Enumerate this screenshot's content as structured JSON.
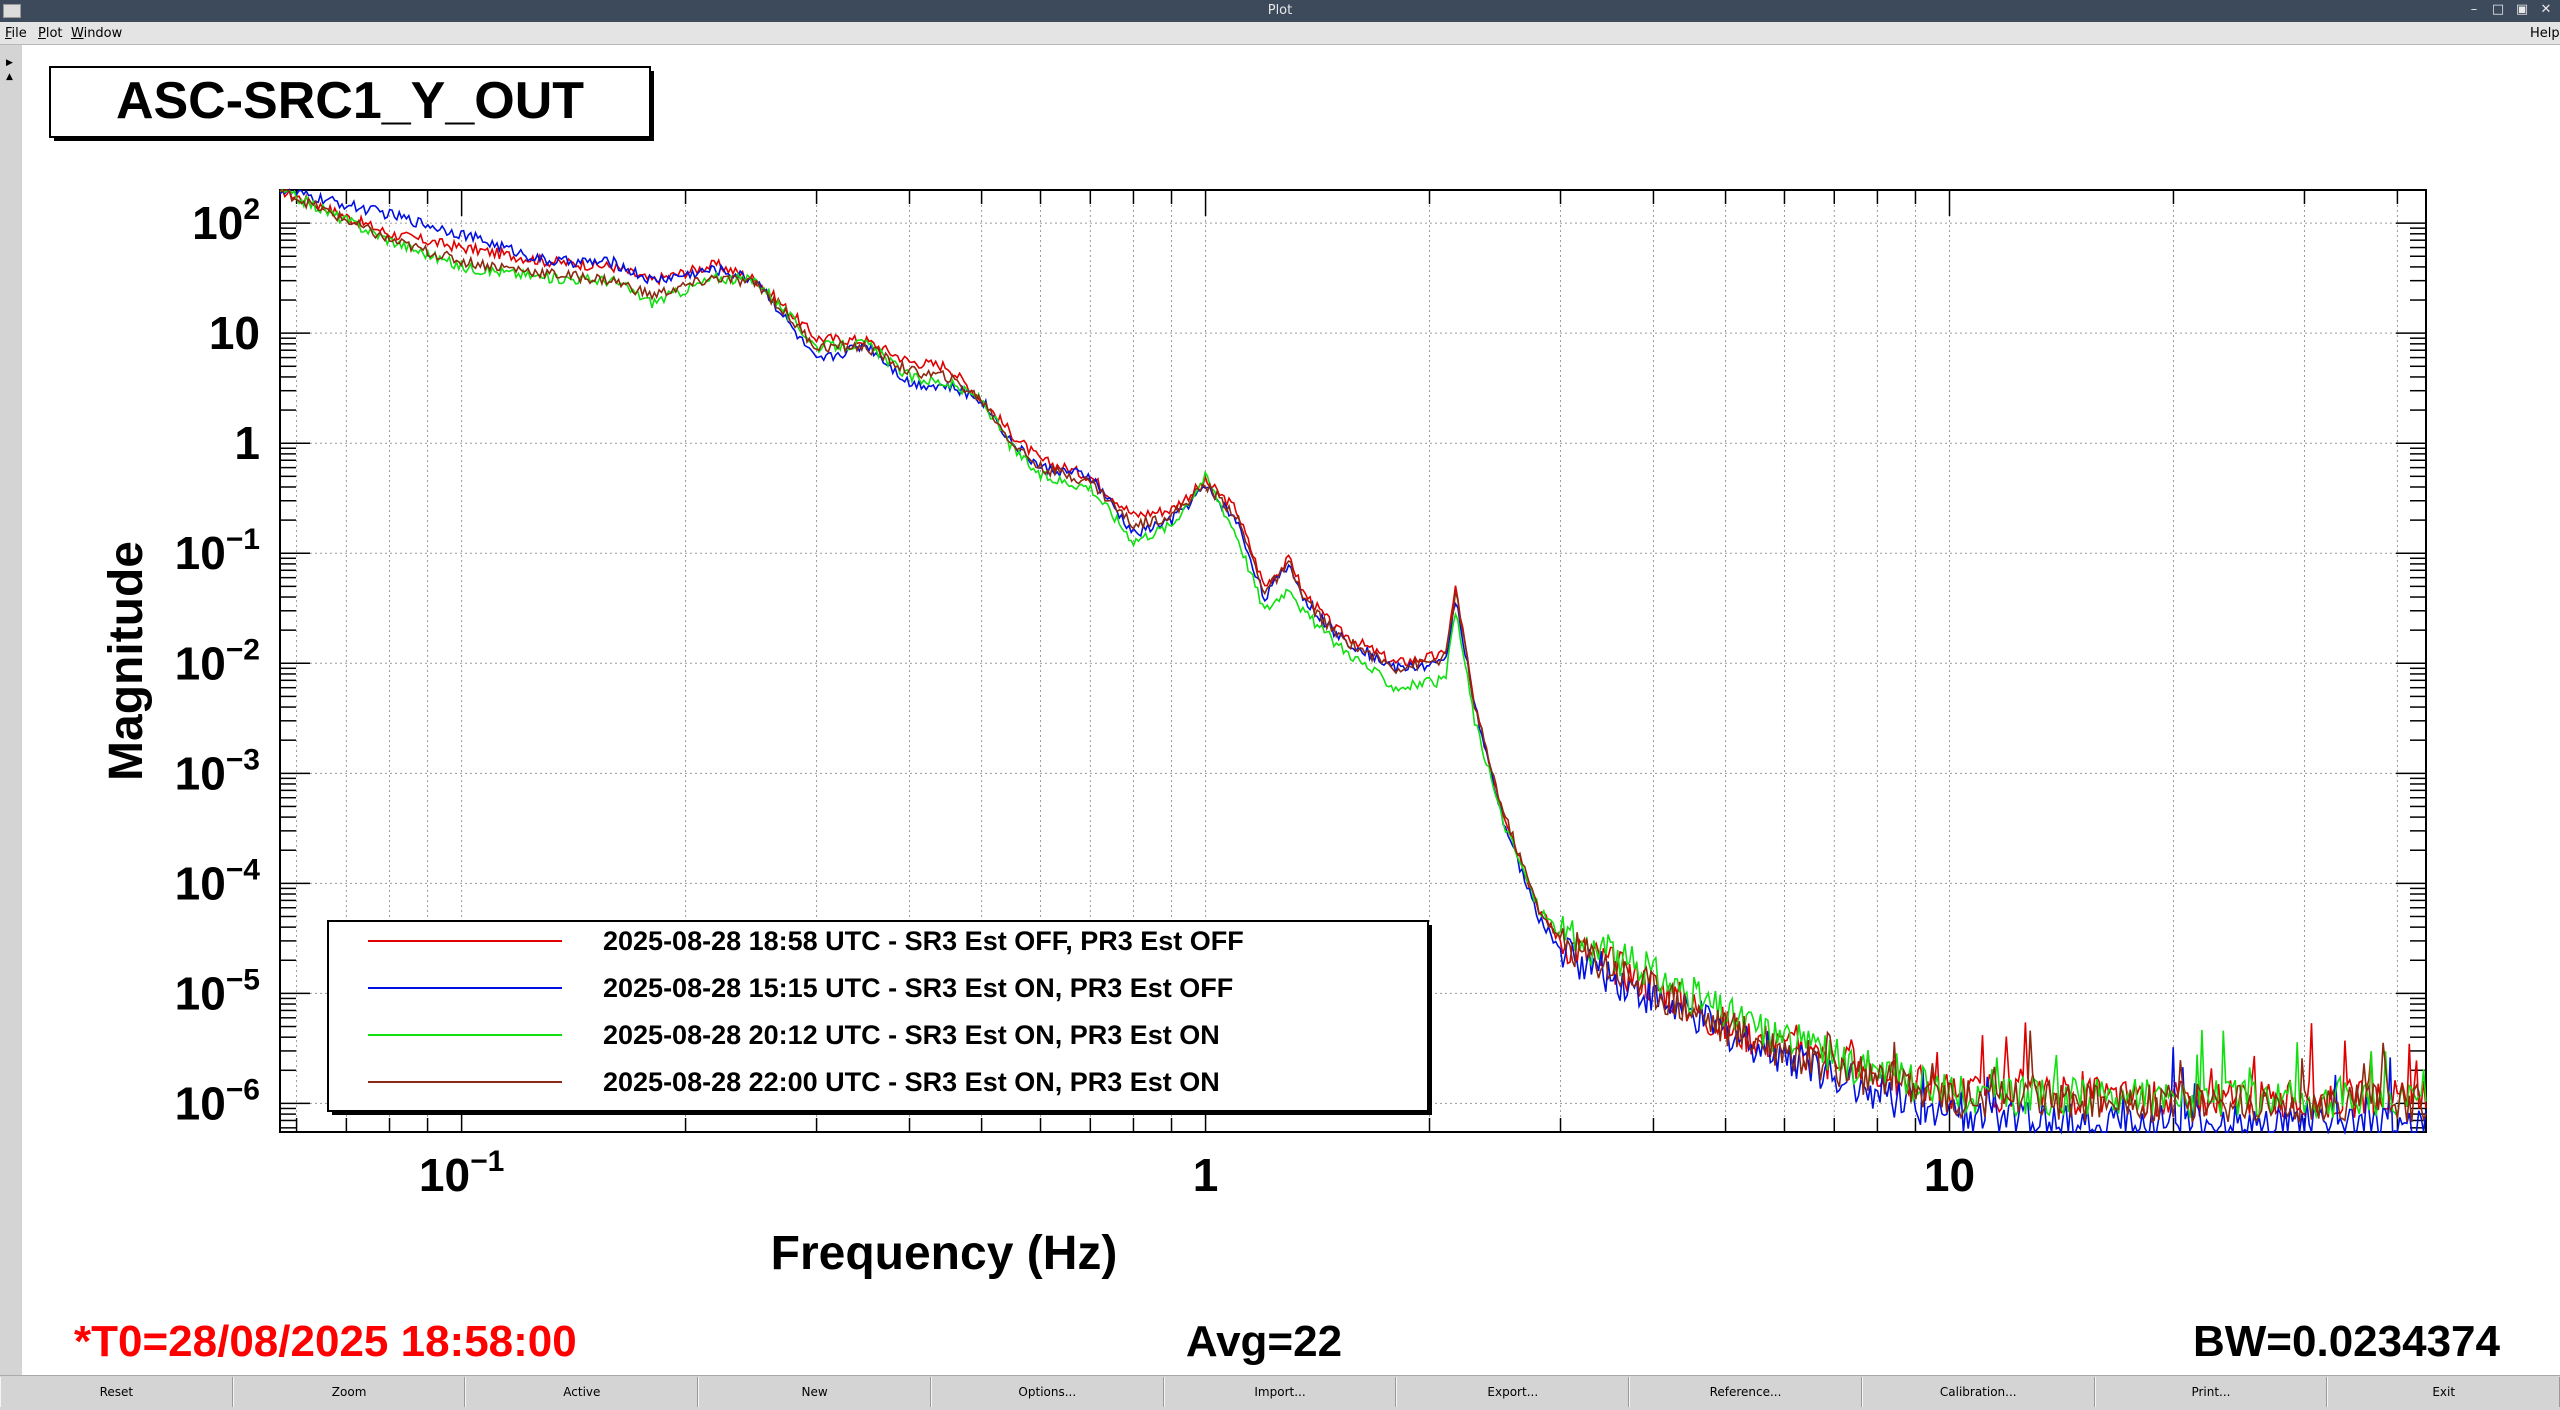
{
  "window": {
    "title": "Plot"
  },
  "menu": [
    {
      "label": "File",
      "key": "F"
    },
    {
      "label": "Plot",
      "key": "P"
    },
    {
      "label": "Window",
      "key": "W"
    }
  ],
  "menu_help": "Help",
  "plot": {
    "title_box": "ASC-SRC1_Y_OUT",
    "footer": {
      "t0": "*T0=28/08/2025 18:58:00",
      "avg": "Avg=22",
      "bw": "BW=0.0234374"
    },
    "legend_colors": [
      "#e00000",
      "#0010e0",
      "#10e010",
      "#8b2a10"
    ]
  },
  "chart_data": {
    "type": "line",
    "title": "",
    "xlabel": "Frequency (Hz)",
    "ylabel": "Magnitude",
    "xscale": "log",
    "yscale": "log",
    "xlim": [
      0.057,
      43.7
    ],
    "ylim": [
      5.5e-07,
      200
    ],
    "grid": true,
    "legend_position": "bottom-left",
    "x_ticks": [
      {
        "value": 0.1,
        "base": "10",
        "exp": "−1"
      },
      {
        "value": 1,
        "base": "1",
        "exp": ""
      },
      {
        "value": 10,
        "base": "10",
        "exp": ""
      }
    ],
    "y_ticks": [
      {
        "value": 100,
        "base": "10",
        "exp": "2"
      },
      {
        "value": 10,
        "base": "10",
        "exp": ""
      },
      {
        "value": 1,
        "base": "1",
        "exp": ""
      },
      {
        "value": 0.1,
        "base": "10",
        "exp": "−1"
      },
      {
        "value": 0.01,
        "base": "10",
        "exp": "−2"
      },
      {
        "value": 0.001,
        "base": "10",
        "exp": "−3"
      },
      {
        "value": 0.0001,
        "base": "10",
        "exp": "−4"
      },
      {
        "value": 1e-05,
        "base": "10",
        "exp": "−5"
      },
      {
        "value": 1e-06,
        "base": "10",
        "exp": "−6"
      }
    ],
    "series": [
      {
        "name": "2025-08-28 18:58 UTC - SR3 Est OFF, PR3 Est OFF",
        "color": "#e00000",
        "points": [
          [
            0.057,
            200
          ],
          [
            0.08,
            80
          ],
          [
            0.1,
            60
          ],
          [
            0.13,
            45
          ],
          [
            0.16,
            40
          ],
          [
            0.18,
            30
          ],
          [
            0.22,
            42
          ],
          [
            0.25,
            30
          ],
          [
            0.3,
            9
          ],
          [
            0.35,
            8.5
          ],
          [
            0.4,
            5.5
          ],
          [
            0.45,
            5
          ],
          [
            0.5,
            2.5
          ],
          [
            0.55,
            1.2
          ],
          [
            0.6,
            0.7
          ],
          [
            0.7,
            0.5
          ],
          [
            0.8,
            0.22
          ],
          [
            0.9,
            0.25
          ],
          [
            1.0,
            0.45
          ],
          [
            1.1,
            0.25
          ],
          [
            1.2,
            0.05
          ],
          [
            1.3,
            0.09
          ],
          [
            1.35,
            0.045
          ],
          [
            1.5,
            0.02
          ],
          [
            1.8,
            0.01
          ],
          [
            2.1,
            0.012
          ],
          [
            2.17,
            0.05
          ],
          [
            2.3,
            0.004
          ],
          [
            2.5,
            0.0005
          ],
          [
            2.8,
            6e-05
          ],
          [
            3.0,
            3e-05
          ],
          [
            4,
            1.2e-05
          ],
          [
            5,
            5e-06
          ],
          [
            7,
            2.3e-06
          ],
          [
            10,
            1.3e-06
          ],
          [
            20,
            1.1e-06
          ],
          [
            40,
            1.1e-06
          ]
        ]
      },
      {
        "name": "2025-08-28 15:15 UTC - SR3 Est ON, PR3 Est OFF",
        "color": "#0010e0",
        "points": [
          [
            0.057,
            200
          ],
          [
            0.08,
            120
          ],
          [
            0.1,
            80
          ],
          [
            0.13,
            45
          ],
          [
            0.16,
            44
          ],
          [
            0.18,
            30
          ],
          [
            0.22,
            38
          ],
          [
            0.25,
            30
          ],
          [
            0.3,
            5.5
          ],
          [
            0.35,
            8
          ],
          [
            0.4,
            3.5
          ],
          [
            0.45,
            3.3
          ],
          [
            0.5,
            2.5
          ],
          [
            0.55,
            1
          ],
          [
            0.6,
            0.6
          ],
          [
            0.7,
            0.5
          ],
          [
            0.8,
            0.15
          ],
          [
            0.9,
            0.2
          ],
          [
            1.0,
            0.4
          ],
          [
            1.1,
            0.2
          ],
          [
            1.2,
            0.04
          ],
          [
            1.3,
            0.08
          ],
          [
            1.35,
            0.04
          ],
          [
            1.5,
            0.018
          ],
          [
            1.8,
            0.009
          ],
          [
            2.1,
            0.01
          ],
          [
            2.17,
            0.04
          ],
          [
            2.3,
            0.004
          ],
          [
            2.5,
            0.0004
          ],
          [
            2.8,
            5e-05
          ],
          [
            3.0,
            2.5e-05
          ],
          [
            4,
            9e-06
          ],
          [
            5,
            4.5e-06
          ],
          [
            7,
            1.8e-06
          ],
          [
            10,
            7e-07
          ],
          [
            20,
            6.5e-07
          ],
          [
            40,
            6e-07
          ]
        ]
      },
      {
        "name": "2025-08-28 20:12 UTC - SR3 Est ON, PR3 Est ON",
        "color": "#10e010",
        "points": [
          [
            0.057,
            200
          ],
          [
            0.08,
            70
          ],
          [
            0.1,
            40
          ],
          [
            0.13,
            32
          ],
          [
            0.16,
            30
          ],
          [
            0.18,
            19
          ],
          [
            0.22,
            32
          ],
          [
            0.25,
            30
          ],
          [
            0.3,
            7.5
          ],
          [
            0.35,
            8
          ],
          [
            0.4,
            4
          ],
          [
            0.45,
            3.5
          ],
          [
            0.5,
            2.5
          ],
          [
            0.55,
            0.9
          ],
          [
            0.6,
            0.5
          ],
          [
            0.7,
            0.4
          ],
          [
            0.8,
            0.13
          ],
          [
            0.9,
            0.18
          ],
          [
            1.0,
            0.5
          ],
          [
            1.1,
            0.15
          ],
          [
            1.2,
            0.03
          ],
          [
            1.3,
            0.05
          ],
          [
            1.35,
            0.03
          ],
          [
            1.5,
            0.015
          ],
          [
            1.8,
            0.006
          ],
          [
            2.1,
            0.007
          ],
          [
            2.17,
            0.03
          ],
          [
            2.3,
            0.003
          ],
          [
            2.5,
            0.0004
          ],
          [
            2.8,
            6e-05
          ],
          [
            3.0,
            3.5e-05
          ],
          [
            4,
            1.5e-05
          ],
          [
            5,
            6.5e-06
          ],
          [
            7,
            2.6e-06
          ],
          [
            10,
            1.2e-06
          ],
          [
            20,
            1.1e-06
          ],
          [
            40,
            1.1e-06
          ]
        ]
      },
      {
        "name": "2025-08-28 22:00 UTC - SR3 Est ON, PR3 Est ON",
        "color": "#8b2a10",
        "points": [
          [
            0.057,
            200
          ],
          [
            0.08,
            70
          ],
          [
            0.1,
            45
          ],
          [
            0.13,
            35
          ],
          [
            0.16,
            30
          ],
          [
            0.18,
            22
          ],
          [
            0.22,
            32
          ],
          [
            0.25,
            28
          ],
          [
            0.3,
            7.5
          ],
          [
            0.35,
            7.5
          ],
          [
            0.4,
            4.5
          ],
          [
            0.45,
            4
          ],
          [
            0.5,
            2.5
          ],
          [
            0.55,
            1
          ],
          [
            0.6,
            0.6
          ],
          [
            0.7,
            0.45
          ],
          [
            0.8,
            0.18
          ],
          [
            0.9,
            0.22
          ],
          [
            1.0,
            0.42
          ],
          [
            1.1,
            0.22
          ],
          [
            1.2,
            0.045
          ],
          [
            1.3,
            0.08
          ],
          [
            1.35,
            0.04
          ],
          [
            1.5,
            0.018
          ],
          [
            1.8,
            0.009
          ],
          [
            2.1,
            0.011
          ],
          [
            2.17,
            0.045
          ],
          [
            2.3,
            0.004
          ],
          [
            2.5,
            0.0005
          ],
          [
            2.8,
            6e-05
          ],
          [
            3.0,
            3e-05
          ],
          [
            4,
            1.1e-05
          ],
          [
            5,
            4.8e-06
          ],
          [
            7,
            2.1e-06
          ],
          [
            10,
            1.1e-06
          ],
          [
            20,
            1e-06
          ],
          [
            40,
            1e-06
          ]
        ]
      }
    ]
  },
  "bottom_buttons": [
    "Reset",
    "Zoom",
    "Active",
    "New",
    "Options...",
    "Import...",
    "Export...",
    "Reference...",
    "Calibration...",
    "Print...",
    "Exit"
  ]
}
